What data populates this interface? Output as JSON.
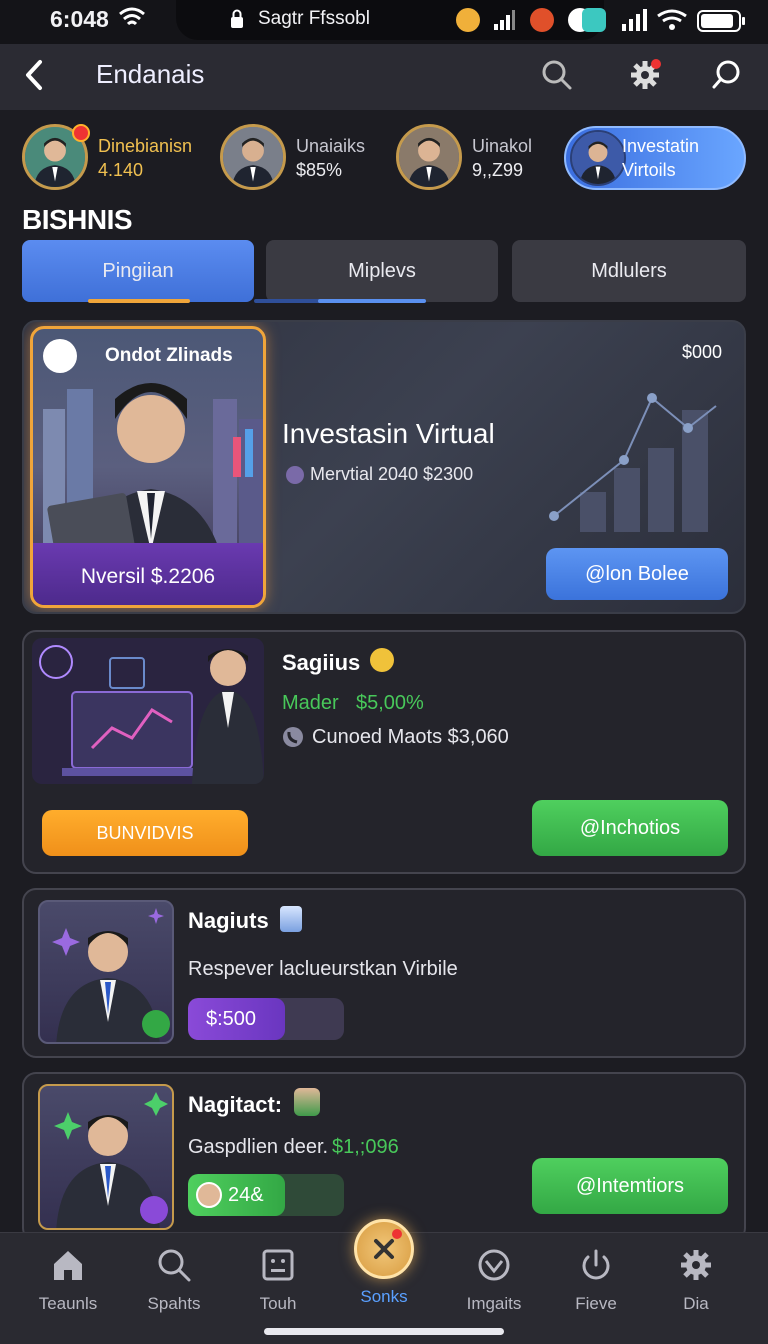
{
  "status_bar": {
    "time": "6:048",
    "center_title": "Sagtr Ffssobl"
  },
  "header": {
    "title": "Endanais"
  },
  "profiles": [
    {
      "name": "Dinebianisn",
      "value": "4.140"
    },
    {
      "name": "Unaiaiks",
      "value": "$85%"
    },
    {
      "name": "Uinakol",
      "value": "9,,Z99"
    },
    {
      "name": "Investatin",
      "value": "Virtoils"
    }
  ],
  "section_title": "BISHNIS",
  "tabs": [
    {
      "label": "Pingiian"
    },
    {
      "label": "Miplevs"
    },
    {
      "label": "Mdlulers"
    }
  ],
  "hero": {
    "image_title": "Ondot Zlinads",
    "image_price": "Nversil $.2206",
    "title": "Investasin Virtual",
    "meta": "Mervtial 2040 $2300",
    "corner_value": "$000",
    "button": "@lon Bolee"
  },
  "card2": {
    "title": "Sagiius",
    "subtitle_label": "Mader",
    "subtitle_value": "$5,00%",
    "info": "Cunoed Maots $3,060",
    "left_button": "BUNVIDVIS",
    "right_button": "@Inchotios"
  },
  "card3": {
    "title": "Nagiuts",
    "desc": "Respever laclueurstkan Virbile",
    "progress_label": "$:500",
    "progress": 0.62
  },
  "card4": {
    "title": "Nagitact:",
    "desc_label": "Gaspdlien deer.",
    "desc_value": "$1,;096",
    "progress_label": "24&",
    "progress": 0.62,
    "button": "@Intemtiors"
  },
  "bottom_nav": [
    {
      "label": "Teaunls",
      "icon": "home-icon"
    },
    {
      "label": "Spahts",
      "icon": "search-icon"
    },
    {
      "label": "Touh",
      "icon": "square-icon"
    },
    {
      "label": "Sonks",
      "icon": "close-icon"
    },
    {
      "label": "Imgaits",
      "icon": "check-circle-icon"
    },
    {
      "label": "Fieve",
      "icon": "power-icon"
    },
    {
      "label": "Dia",
      "icon": "gear-icon"
    }
  ],
  "colors": {
    "accent_blue": "#3f70d8",
    "accent_green": "#33a845",
    "accent_orange": "#f0901a",
    "accent_purple": "#6a3ab0",
    "background": "#1c1c22"
  }
}
